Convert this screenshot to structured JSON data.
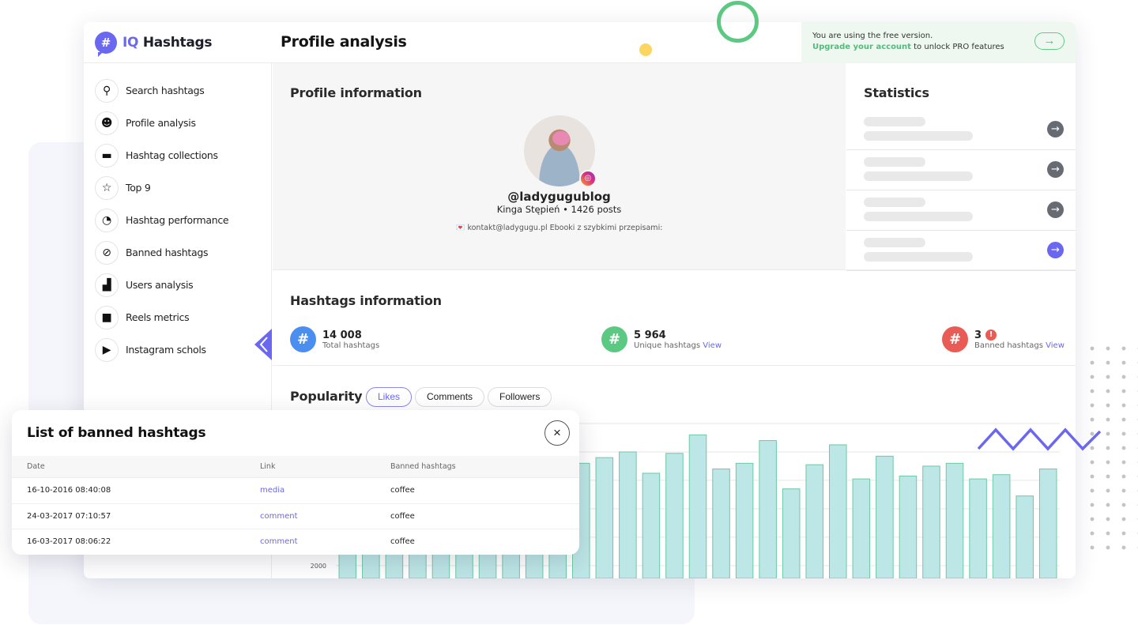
{
  "app": {
    "logo_prefix": "IQ",
    "logo_name": "Hashtags",
    "logo_icon": "#"
  },
  "header": {
    "title": "Profile analysis"
  },
  "promo": {
    "line1": "You are using the free version.",
    "upgrade_link": "Upgrade your account",
    "line2": " to unlock PRO features",
    "button_icon": "→"
  },
  "sidebar": {
    "items": [
      {
        "label": "Search hashtags",
        "icon": "search-icon",
        "glyph": "⚲"
      },
      {
        "label": "Profile analysis",
        "icon": "face-icon",
        "glyph": "☻"
      },
      {
        "label": "Hashtag collections",
        "icon": "folder-icon",
        "glyph": "▬"
      },
      {
        "label": "Top 9",
        "icon": "star-icon",
        "glyph": "☆"
      },
      {
        "label": "Hashtag performance",
        "icon": "gauge-icon",
        "glyph": "◔"
      },
      {
        "label": "Banned hashtags",
        "icon": "ban-icon",
        "glyph": "⊘"
      },
      {
        "label": "Users analysis",
        "icon": "bar-chart-icon",
        "glyph": "▟"
      },
      {
        "label": "Reels metrics",
        "icon": "video-icon",
        "glyph": "■"
      },
      {
        "label": "Instagram schols",
        "icon": "play-icon",
        "glyph": "▶"
      }
    ]
  },
  "profile": {
    "title": "Profile information",
    "handle": "@ladygugublog",
    "name_posts": "Kinga Stępień • 1426 posts",
    "bio": "💌 kontakt@ladygugu.pl Ebooki z szybkimi przepisami:"
  },
  "statistics": {
    "title": "Statistics",
    "rows": 4,
    "active_row": 3
  },
  "hashtags": {
    "title": "Hashtags information",
    "total": {
      "value": "14 008",
      "label": "Total hashtags",
      "color": "#4a8ef0"
    },
    "unique": {
      "value": "5 964",
      "label": "Unique hashtags",
      "link": "View",
      "color": "#5cc983"
    },
    "banned": {
      "value": "3",
      "label": "Banned hashtags",
      "link": "View",
      "color": "#e95b55",
      "warn": "!"
    }
  },
  "popularity": {
    "title": "Popularity",
    "tabs": [
      "Likes",
      "Comments",
      "Followers"
    ],
    "active_tab": "Likes"
  },
  "chart_data": {
    "type": "bar",
    "title": "Popularity",
    "series": [
      {
        "name": "Likes",
        "values": [
          9500,
          9000,
          9800,
          10100,
          8700,
          9300,
          10400,
          9700,
          8900,
          9600,
          9200,
          9600,
          10000,
          8500,
          9900,
          11200,
          8800,
          9200,
          10800,
          7400,
          9100,
          10500,
          8100,
          9700,
          8300,
          9000,
          9200,
          8100,
          8400,
          6900,
          8800
        ]
      }
    ],
    "ylabel": "",
    "xlabel": "",
    "yticks": [
      2000
    ],
    "ylim": [
      1100,
      13000
    ],
    "grid": true,
    "bar_color": "#bde6e6",
    "bar_stroke": "#6cc9a4"
  },
  "modal": {
    "title": "List of banned hashtags",
    "close_icon": "×",
    "columns": [
      "Date",
      "Link",
      "Banned hashtags"
    ],
    "rows": [
      {
        "date": "16-10-2016 08:40:08",
        "link": "media",
        "hashtag": "coffee"
      },
      {
        "date": "24-03-2017 07:10:57",
        "link": "comment",
        "hashtag": "coffee"
      },
      {
        "date": "16-03-2017 08:06:22",
        "link": "comment",
        "hashtag": "coffee"
      }
    ]
  }
}
